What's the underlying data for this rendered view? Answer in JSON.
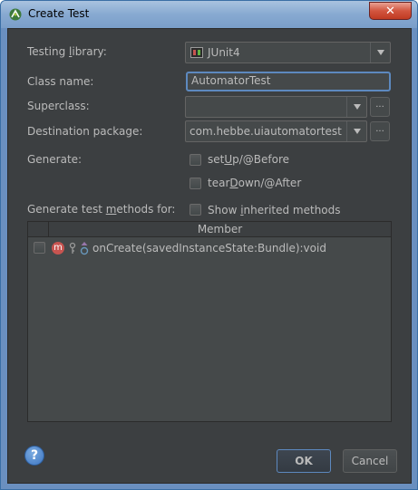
{
  "window": {
    "title": "Create Test"
  },
  "form": {
    "testing_library_label_pre": "Testing ",
    "testing_library_label_ul": "l",
    "testing_library_label_post": "ibrary:",
    "testing_library_value": "JUnit4",
    "class_name_label": "Class name:",
    "class_name_value": "AutomatorTest",
    "superclass_label": "Superclass:",
    "superclass_value": "",
    "destination_package_label": "Destination package:",
    "destination_package_value": "com.hebbe.uiautomatortest",
    "browse_label": "...",
    "generate_label": "Generate:",
    "setup_pre": "set",
    "setup_ul": "U",
    "setup_post": "p/@Before",
    "teardown_pre": "tear",
    "teardown_ul": "D",
    "teardown_post": "own/@After",
    "methods_label_pre": "Generate test ",
    "methods_label_ul": "m",
    "methods_label_post": "ethods for:",
    "show_inherited_pre": "Show ",
    "show_inherited_ul": "i",
    "show_inherited_post": "nherited methods"
  },
  "table": {
    "header": "Member",
    "rows": [
      {
        "icon": "m",
        "text": "onCreate(savedInstanceState:Bundle):void"
      }
    ]
  },
  "buttons": {
    "help": "?",
    "ok": "OK",
    "cancel": "Cancel"
  }
}
